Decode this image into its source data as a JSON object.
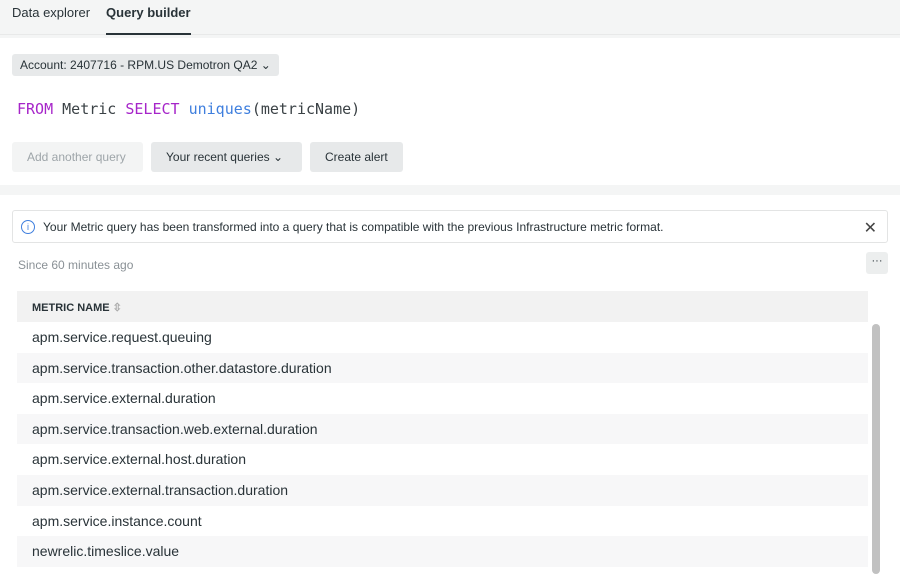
{
  "tabs": [
    {
      "label": "Data explorer",
      "active": false
    },
    {
      "label": "Query builder",
      "active": true
    }
  ],
  "account": "Account: 2407716 - RPM.US Demotron QA2 ⌄",
  "query": {
    "from": "FROM",
    "table": "Metric",
    "select": "SELECT",
    "fn": "uniques",
    "open": "(",
    "arg": "metricName",
    "close": ")"
  },
  "buttons": {
    "add": "Add another query",
    "recent": "Your recent queries  ⌄",
    "alert": "Create alert"
  },
  "notice": {
    "text": "Your Metric query has been transformed into a query that is compatible with the previous Infrastructure metric format.",
    "icon": "info-icon",
    "close": "✕"
  },
  "since": "Since 60 minutes ago",
  "more": "···",
  "table": {
    "header": "METRIC NAME",
    "sort": "⇳",
    "rows": [
      "apm.service.request.queuing",
      "apm.service.transaction.other.datastore.duration",
      "apm.service.external.duration",
      "apm.service.transaction.web.external.duration",
      "apm.service.external.host.duration",
      "apm.service.external.transaction.duration",
      "apm.service.instance.count",
      "newrelic.timeslice.value"
    ]
  }
}
